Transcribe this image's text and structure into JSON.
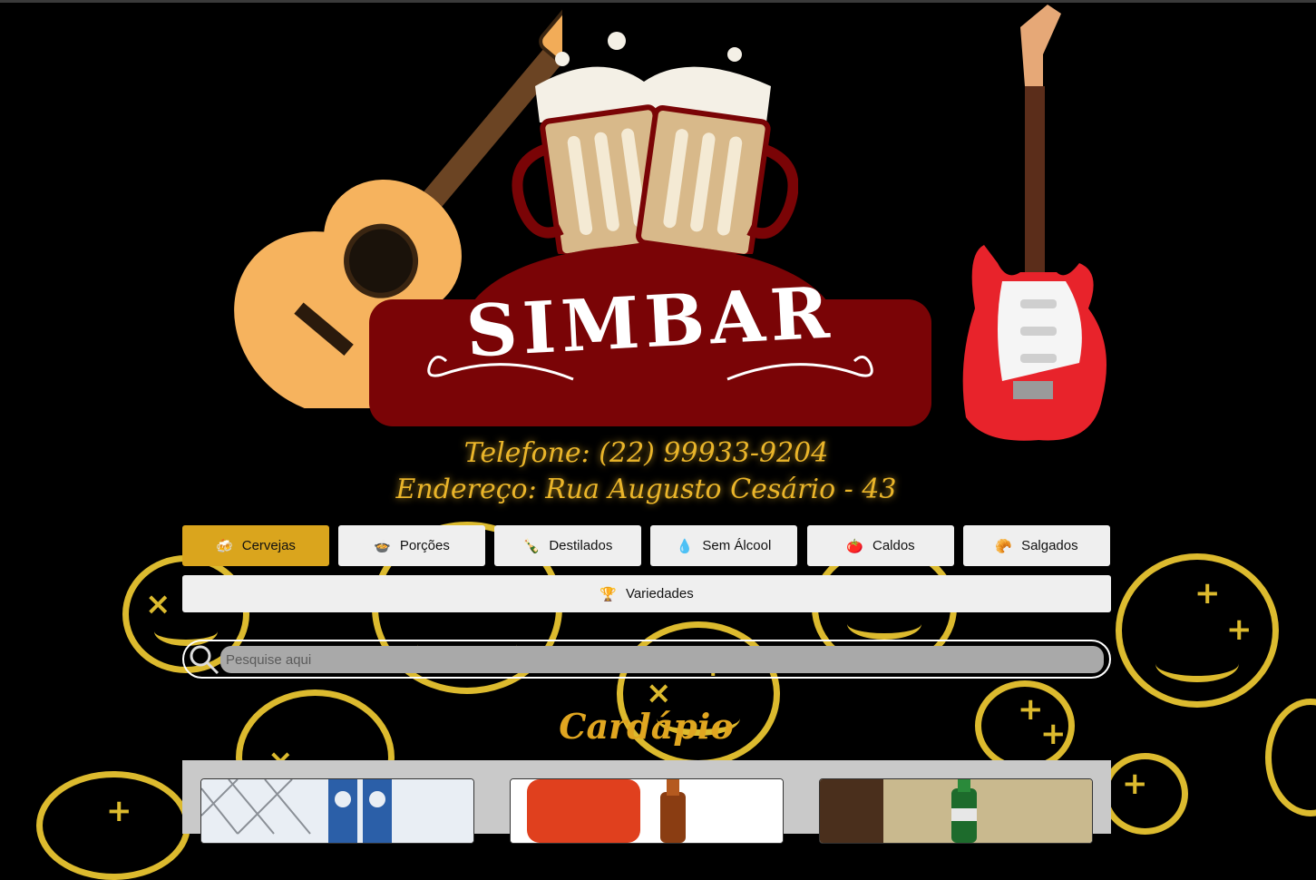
{
  "brand": {
    "name": "SIMBAR"
  },
  "contact": {
    "phone": "Telefone: (22) 99933-9204",
    "address": "Endereço: Rua Augusto Cesário - 43"
  },
  "categories": [
    {
      "label": "Cervejas",
      "icon": "beer-icon",
      "glyph": "🍻",
      "active": true
    },
    {
      "label": "Porções",
      "icon": "food-plate-icon",
      "glyph": "🍲"
    },
    {
      "label": "Destilados",
      "icon": "liquor-bottle-icon",
      "glyph": "🍾"
    },
    {
      "label": "Sem Álcool",
      "icon": "water-bottle-icon",
      "glyph": "💧"
    },
    {
      "label": "Caldos",
      "icon": "soup-bowl-icon",
      "glyph": "🍅"
    },
    {
      "label": "Salgados",
      "icon": "snack-icon",
      "glyph": "🥐"
    },
    {
      "label": "Variedades",
      "icon": "trophy-icon",
      "glyph": "🏆"
    }
  ],
  "search": {
    "placeholder": "Pesquise aqui",
    "value": ""
  },
  "menu": {
    "title": "Cardápio"
  },
  "colors": {
    "background": "#000000",
    "accent_gold": "#daa51d",
    "banner_red": "#7a0406",
    "doodle_yellow": "#e8c531"
  }
}
